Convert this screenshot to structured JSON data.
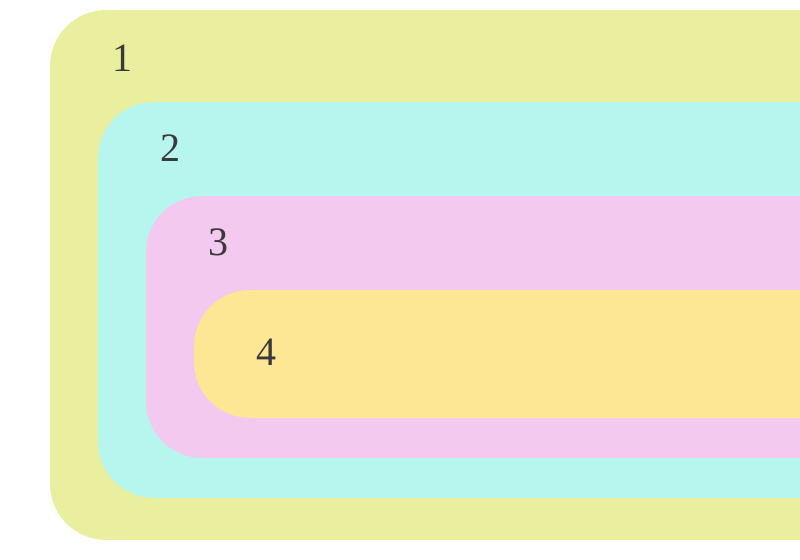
{
  "diagram": {
    "layers": [
      {
        "label": "1",
        "color": "#e9ef9e"
      },
      {
        "label": "2",
        "color": "#b7f5ef"
      },
      {
        "label": "3",
        "color": "#f3c9f0"
      },
      {
        "label": "4",
        "color": "#fde795"
      }
    ]
  }
}
